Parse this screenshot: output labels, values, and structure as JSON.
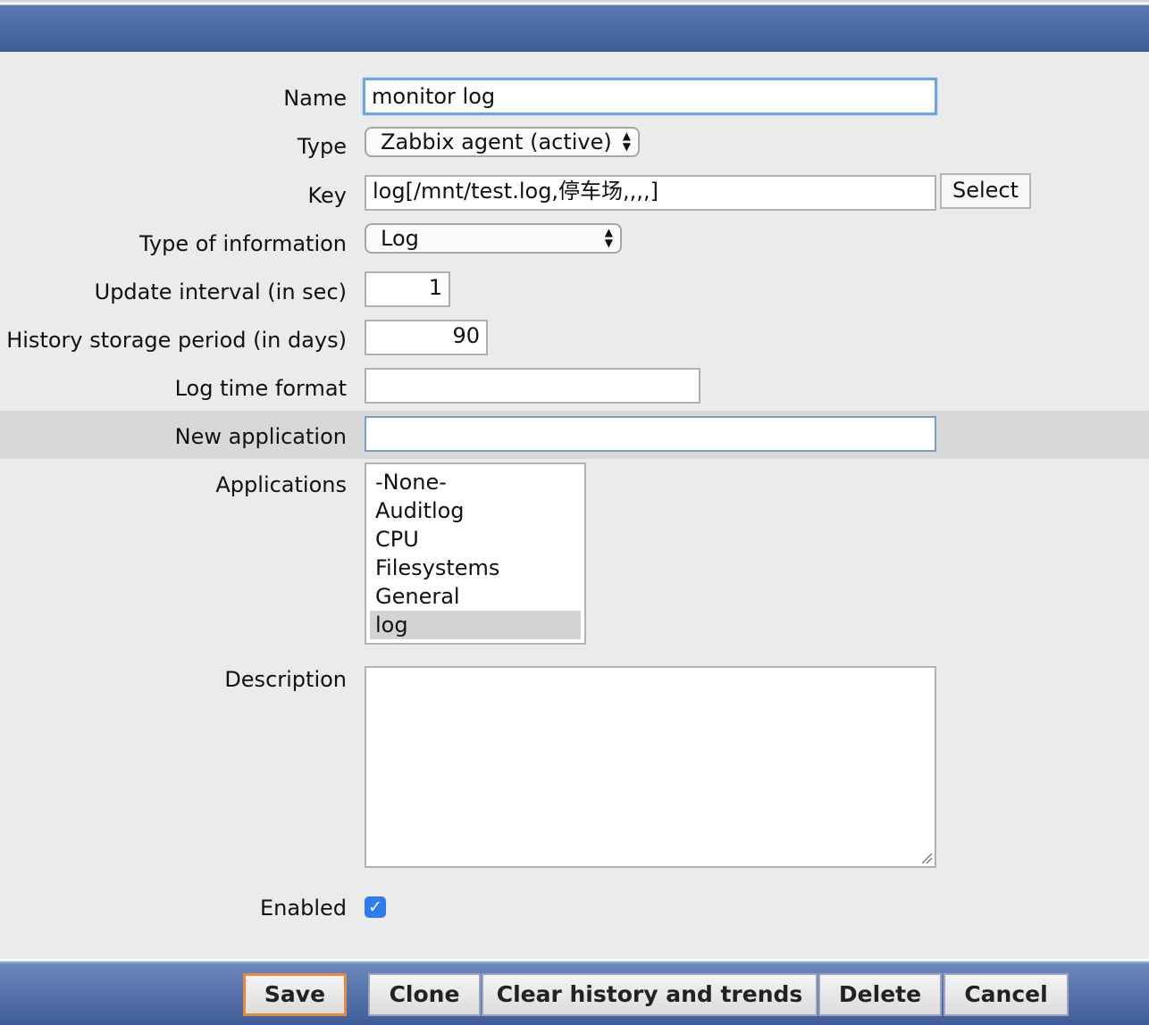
{
  "form": {
    "name": {
      "label": "Name",
      "value": "monitor log"
    },
    "type": {
      "label": "Type",
      "value": "Zabbix agent (active)"
    },
    "key": {
      "label": "Key",
      "value": "log[/mnt/test.log,停车场,,,,]",
      "select_label": "Select"
    },
    "type_of_information": {
      "label": "Type of information",
      "value": "Log"
    },
    "update_interval": {
      "label": "Update interval (in sec)",
      "value": "1"
    },
    "history_storage": {
      "label": "History storage period (in days)",
      "value": "90"
    },
    "log_time_format": {
      "label": "Log time format",
      "value": ""
    },
    "new_application": {
      "label": "New application",
      "value": ""
    },
    "applications": {
      "label": "Applications",
      "items": [
        "-None-",
        "Auditlog",
        "CPU",
        "Filesystems",
        "General",
        "log"
      ],
      "selected": "log"
    },
    "description": {
      "label": "Description",
      "value": ""
    },
    "enabled": {
      "label": "Enabled",
      "checked": true
    }
  },
  "footer": {
    "save": "Save",
    "clone": "Clone",
    "clear_history": "Clear history and trends",
    "delete": "Delete",
    "cancel": "Cancel"
  },
  "colors": {
    "header_blue": "#3e5d98",
    "focus_ring": "#6ea3e6",
    "primary_button_border": "#e88a3c",
    "checkbox_blue": "#2f7bf0"
  }
}
